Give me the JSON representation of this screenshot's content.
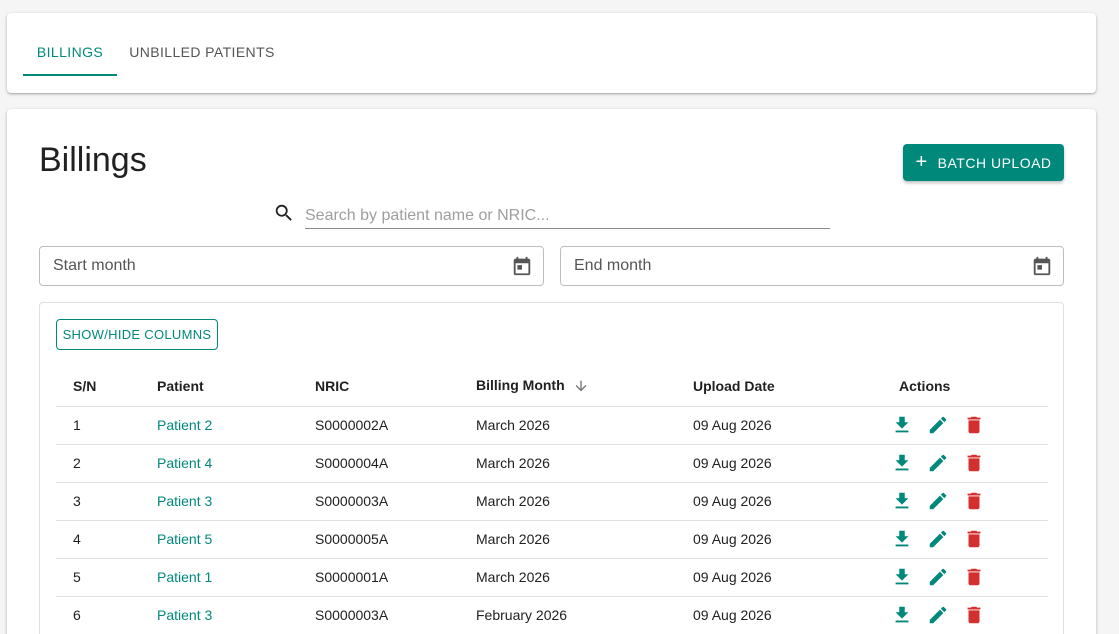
{
  "tabs": [
    {
      "label": "BILLINGS",
      "active": true
    },
    {
      "label": "UNBILLED PATIENTS",
      "active": false
    }
  ],
  "page": {
    "title": "Billings",
    "batch_upload_label": "BATCH UPLOAD"
  },
  "search": {
    "placeholder": "Search by patient name or NRIC...",
    "value": ""
  },
  "filters": {
    "start_placeholder": "Start month",
    "end_placeholder": "End month"
  },
  "table": {
    "show_hide_label": "SHOW/HIDE COLUMNS",
    "headers": {
      "sn": "S/N",
      "patient": "Patient",
      "nric": "NRIC",
      "billing_month": "Billing Month",
      "upload_date": "Upload Date",
      "actions": "Actions"
    },
    "sort": {
      "column": "billing_month",
      "direction": "descending"
    },
    "rows": [
      {
        "sn": "1",
        "patient": "Patient 2",
        "nric": "S0000002A",
        "billing_month": "March 2026",
        "upload_date": "09 Aug 2026"
      },
      {
        "sn": "2",
        "patient": "Patient 4",
        "nric": "S0000004A",
        "billing_month": "March 2026",
        "upload_date": "09 Aug 2026"
      },
      {
        "sn": "3",
        "patient": "Patient 3",
        "nric": "S0000003A",
        "billing_month": "March 2026",
        "upload_date": "09 Aug 2026"
      },
      {
        "sn": "4",
        "patient": "Patient 5",
        "nric": "S0000005A",
        "billing_month": "March 2026",
        "upload_date": "09 Aug 2026"
      },
      {
        "sn": "5",
        "patient": "Patient 1",
        "nric": "S0000001A",
        "billing_month": "March 2026",
        "upload_date": "09 Aug 2026"
      },
      {
        "sn": "6",
        "patient": "Patient 3",
        "nric": "S0000003A",
        "billing_month": "February 2026",
        "upload_date": "09 Aug 2026"
      }
    ]
  },
  "icons": {
    "search": "search-icon",
    "calendar": "calendar-icon",
    "download": "download-icon",
    "edit": "edit-icon",
    "delete": "delete-icon",
    "sort": "arrow-down-icon",
    "add": "plus-icon"
  },
  "colors": {
    "accent": "#00897b",
    "danger": "#d32f2f"
  }
}
